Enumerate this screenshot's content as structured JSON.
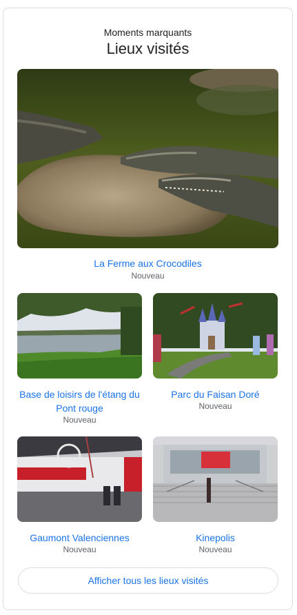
{
  "header": {
    "eyebrow": "Moments marquants",
    "title": "Lieux visités"
  },
  "places": [
    {
      "name": "La Ferme aux Crocodiles",
      "status": "Nouveau",
      "image_icon": "crocodiles-photo"
    },
    {
      "name": "Base de loisirs de l'étang du Pont rouge",
      "status": "Nouveau",
      "image_icon": "lake-photo"
    },
    {
      "name": "Parc du Faisan Doré",
      "status": "Nouveau",
      "image_icon": "castle-park-photo"
    },
    {
      "name": "Gaumont Valenciennes",
      "status": "Nouveau",
      "image_icon": "cinema-lobby-photo"
    },
    {
      "name": "Kinepolis",
      "status": "Nouveau",
      "image_icon": "cinema-building-photo"
    }
  ],
  "show_all_label": "Afficher tous les lieux visités",
  "colors": {
    "link": "#1a73e8",
    "secondary_text": "#5f6368",
    "border": "#dadce0"
  }
}
